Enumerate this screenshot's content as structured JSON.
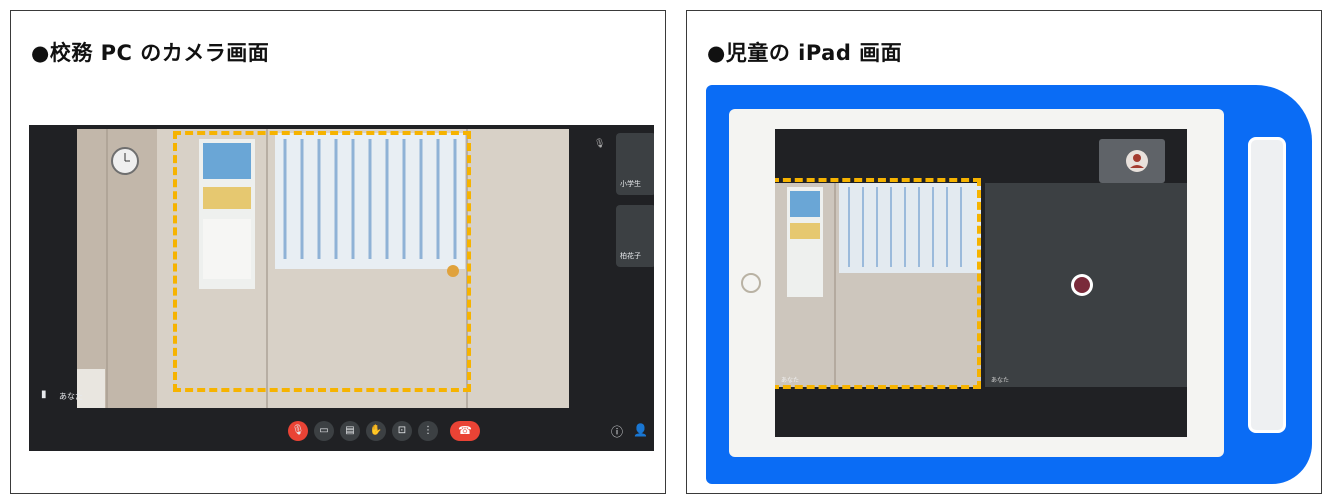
{
  "left_panel": {
    "title": "●校務 PC のカメラ画面",
    "meet": {
      "self_label": "あなた",
      "participants": [
        "小学生",
        "柏花子"
      ],
      "controls": [
        "mic-off-icon",
        "camera-icon",
        "captions-icon",
        "raise-hand-icon",
        "present-icon",
        "more-icon",
        "end-call-icon"
      ]
    }
  },
  "right_panel": {
    "title": "●児童の iPad 画面",
    "ipad": {
      "tile_labels": [
        "あなた",
        "あなた"
      ]
    }
  },
  "colors": {
    "dashed_highlight": "#f6b300",
    "ipad_frame": "#0a6cf5",
    "meet_background": "#202124",
    "end_call": "#ea4335"
  }
}
